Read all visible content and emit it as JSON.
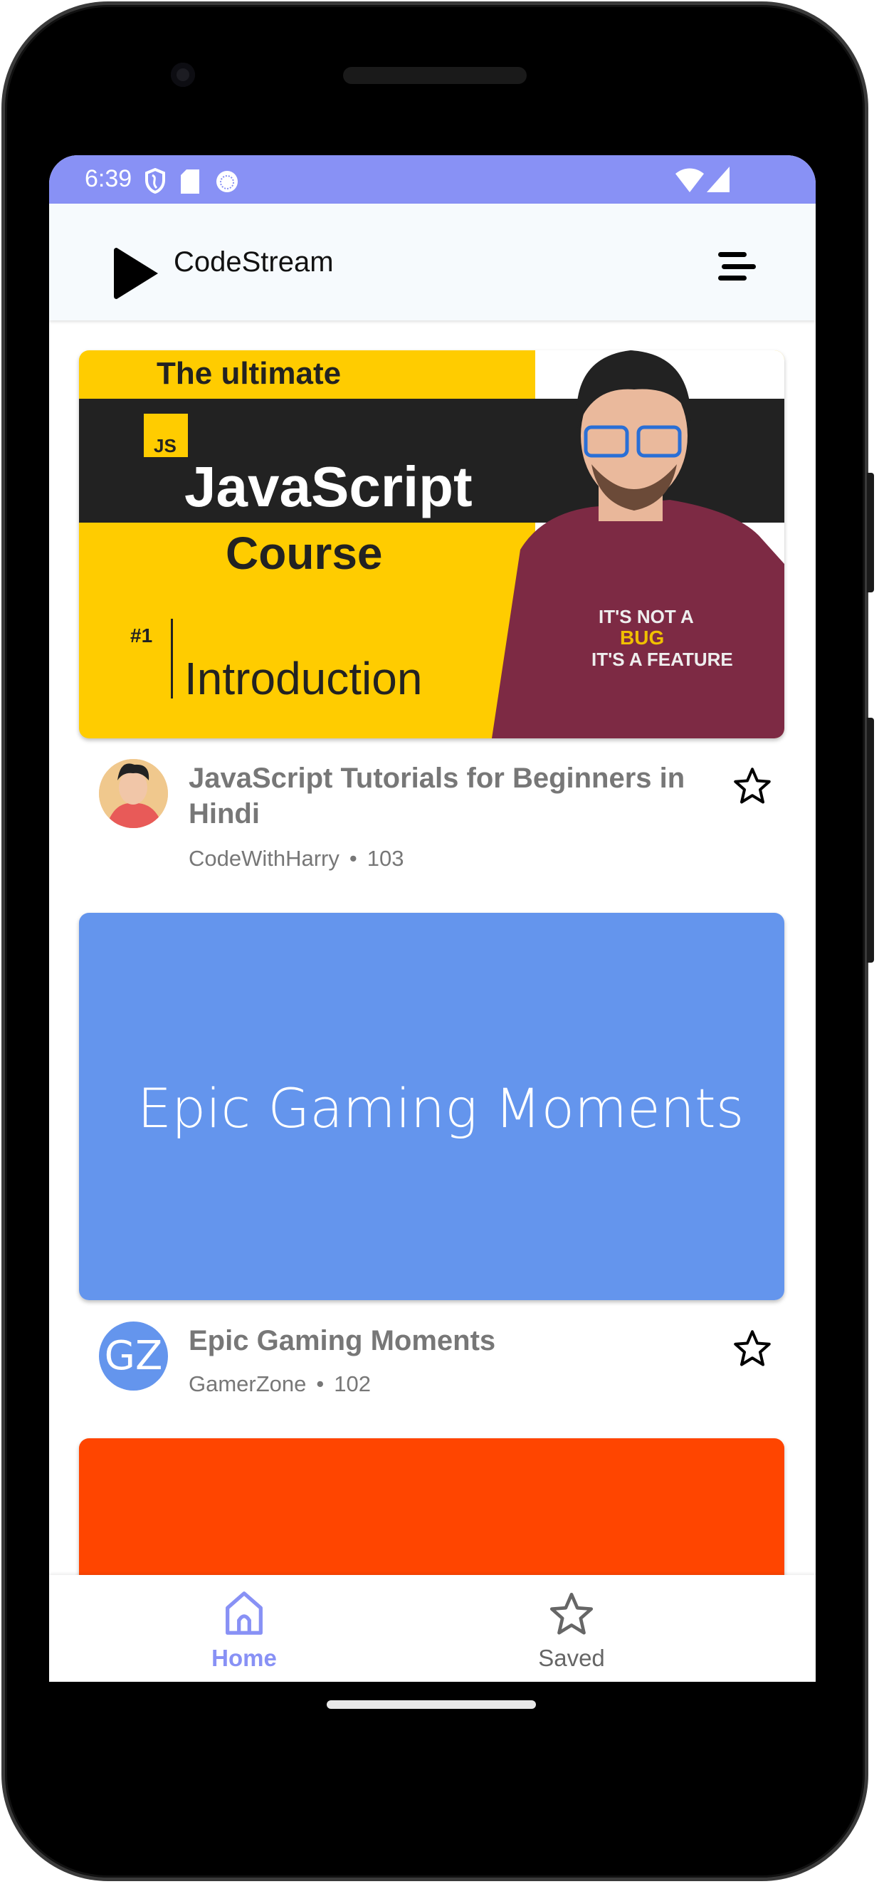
{
  "status_bar": {
    "time": "6:39",
    "icons": [
      "shield-icon",
      "sd-card-icon",
      "sync-icon",
      "wifi-icon",
      "signal-icon"
    ]
  },
  "header": {
    "app_name": "CodeStream",
    "menu_icon": "menu-icon"
  },
  "videos": [
    {
      "thumbnail": {
        "line1": "The ultimate",
        "badge": "JS",
        "line2": "JavaScript",
        "line3": "Course",
        "episode": "#1",
        "line4": "Introduction",
        "shirt_line1": "IT'S NOT A",
        "shirt_line2": "BUG",
        "shirt_line3": "IT'S A FEATURE"
      },
      "title": "JavaScript Tutorials for Beginners in Hindi",
      "channel": "CodeWithHarry",
      "count": "103"
    },
    {
      "thumbnail": {
        "text": "Epic Gaming Moments",
        "color": "#6495ED"
      },
      "avatar_initials": "GZ",
      "title": "Epic Gaming Moments",
      "channel": "GamerZone",
      "count": "102"
    },
    {
      "thumbnail": {
        "color": "#FF4500"
      }
    }
  ],
  "bottom_nav": {
    "items": [
      {
        "label": "Home",
        "active": true
      },
      {
        "label": "Saved",
        "active": false
      }
    ]
  },
  "colors": {
    "accent": "#8891F5",
    "text_muted": "#777777"
  }
}
